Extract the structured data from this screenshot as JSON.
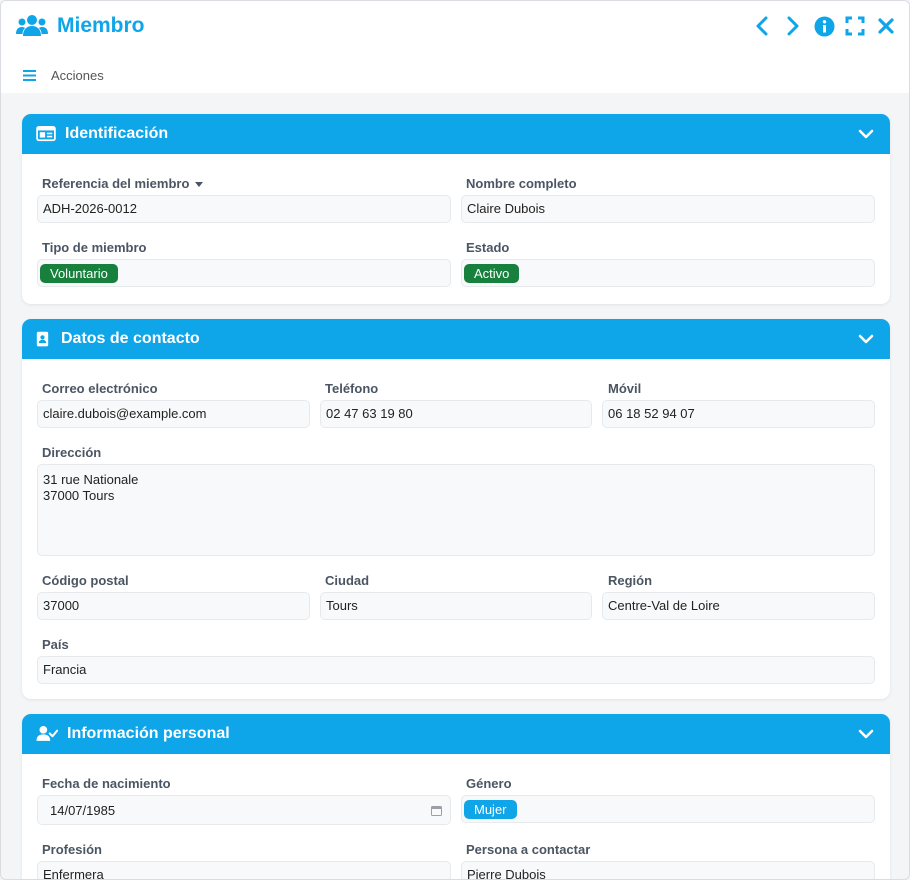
{
  "window": {
    "title": "Miembro",
    "actions_label": "Acciones",
    "accent": "#0ea5e9"
  },
  "identificacion": {
    "title": "Identificación",
    "ref_label": "Referencia del miembro",
    "ref_value": "ADH-2026-0012",
    "nombre_label": "Nombre completo",
    "nombre_value": "Claire Dubois",
    "tipo_label": "Tipo de miembro",
    "tipo_value": "Voluntario",
    "estado_label": "Estado",
    "estado_value": "Activo"
  },
  "contacto": {
    "title": "Datos de contacto",
    "email_label": "Correo electrónico",
    "email_value": "claire.dubois@example.com",
    "telefono_label": "Teléfono",
    "telefono_value": "02 47 63 19 80",
    "movil_label": "Móvil",
    "movil_value": "06 18 52 94 07",
    "direccion_label": "Dirección",
    "direccion_value": "31 rue Nationale\n37000 Tours",
    "cp_label": "Código postal",
    "cp_value": "37000",
    "ciudad_label": "Ciudad",
    "ciudad_value": "Tours",
    "region_label": "Región",
    "region_value": "Centre-Val de Loire",
    "pais_label": "País",
    "pais_value": "Francia"
  },
  "personal": {
    "title": "Información personal",
    "nacimiento_label": "Fecha de nacimiento",
    "nacimiento_value": "14/07/1985",
    "genero_label": "Género",
    "genero_value": "Mujer",
    "profesion_label": "Profesión",
    "profesion_value": "Enfermera",
    "contacto_label": "Persona a contactar",
    "contacto_value": "Pierre Dubois"
  },
  "icons": {
    "title": "users-icon",
    "prev": "chevron-left-icon",
    "next": "chevron-right-icon",
    "info": "info-icon",
    "expand": "expand-icon",
    "close": "close-icon",
    "menu": "hamburger-icon",
    "identificacion": "id-card-icon",
    "contacto": "address-book-icon",
    "personal": "user-check-icon",
    "collapse": "chevron-down-icon",
    "calendar": "calendar-icon"
  }
}
